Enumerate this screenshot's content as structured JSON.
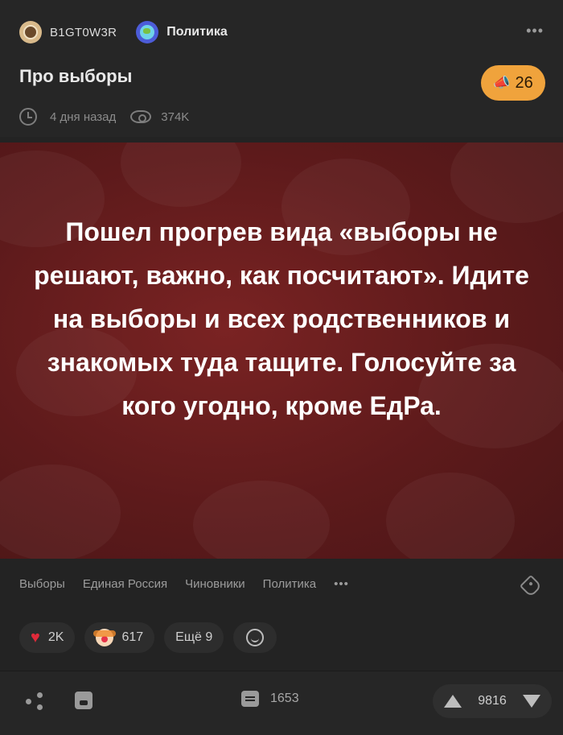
{
  "post": {
    "author": "B1GT0W3R",
    "community": "Политика",
    "more_label": "•••",
    "title": "Про выборы",
    "rating_badge": "26",
    "time_ago": "4 дня назад",
    "views": "374K"
  },
  "image": {
    "text": "Пошел прогрев вида «выборы не решают, важно, как посчитают». Идите на выборы и всех родственников и знакомых туда тащите. Голосуйте за кого угодно, кроме ЕдРа."
  },
  "tags": [
    "Выборы",
    "Единая Россия",
    "Чиновники",
    "Политика"
  ],
  "tags_more": "•••",
  "reactions": {
    "likes": "2K",
    "clown": "617",
    "more": "Ещё 9"
  },
  "footer": {
    "comments": "1653",
    "votes": "9816"
  },
  "colors": {
    "background": "#232323",
    "accent_badge": "#f0a33c",
    "image_bg": "#6b1f20",
    "heart": "#e02a3a"
  }
}
